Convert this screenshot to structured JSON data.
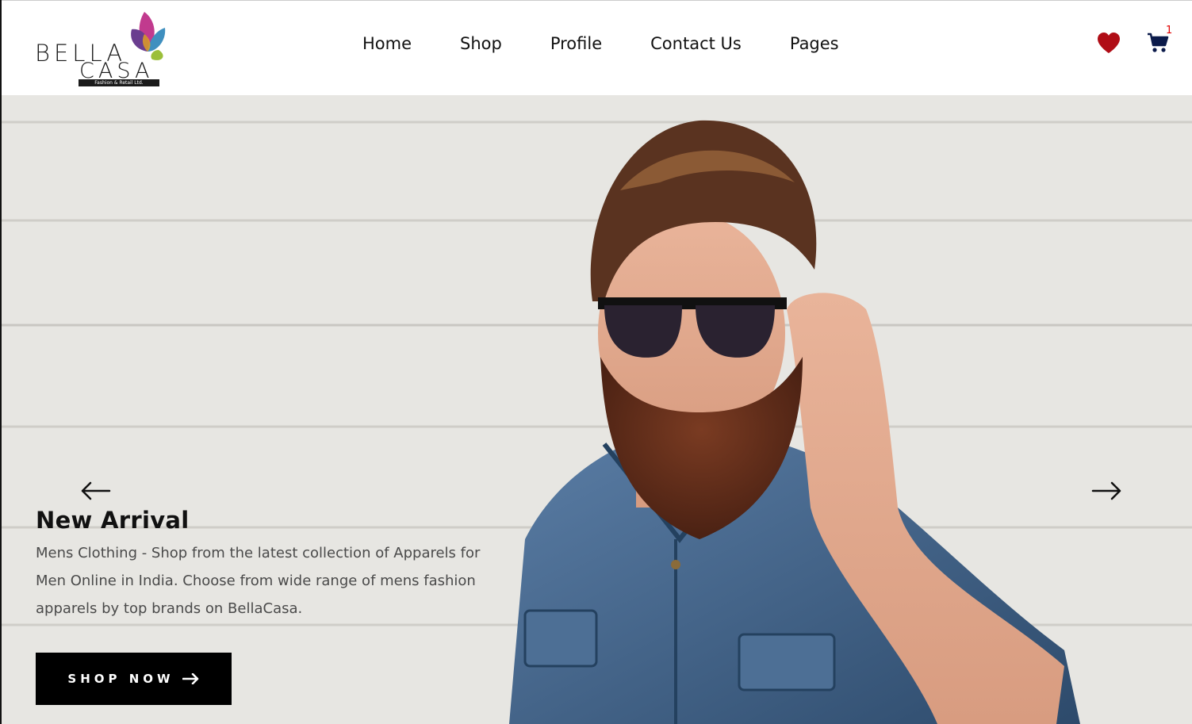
{
  "header": {
    "logo": {
      "word1": "BELLA",
      "word2": "CASA",
      "tagline": "Fashion & Retail Ltd."
    },
    "nav": [
      "Home",
      "Shop",
      "Profile",
      "Contact Us",
      "Pages"
    ],
    "cart_count": "1"
  },
  "hero": {
    "title": "New Arrival",
    "description": "Mens Clothing - Shop from the latest collection of Apparels for Men Online in India. Choose from wide range of mens fashion apparels by top brands on BellaCasa.",
    "button_label": "SHOP NOW"
  },
  "colors": {
    "heart": "#b00d16",
    "cart": "#0b1a4a",
    "cart_badge": "#e10000",
    "button_bg": "#000000",
    "hero_bg": "#e7e6e2"
  },
  "icons": [
    "heart-icon",
    "cart-icon",
    "arrow-left-icon",
    "arrow-right-icon",
    "arrow-right-small-icon"
  ]
}
